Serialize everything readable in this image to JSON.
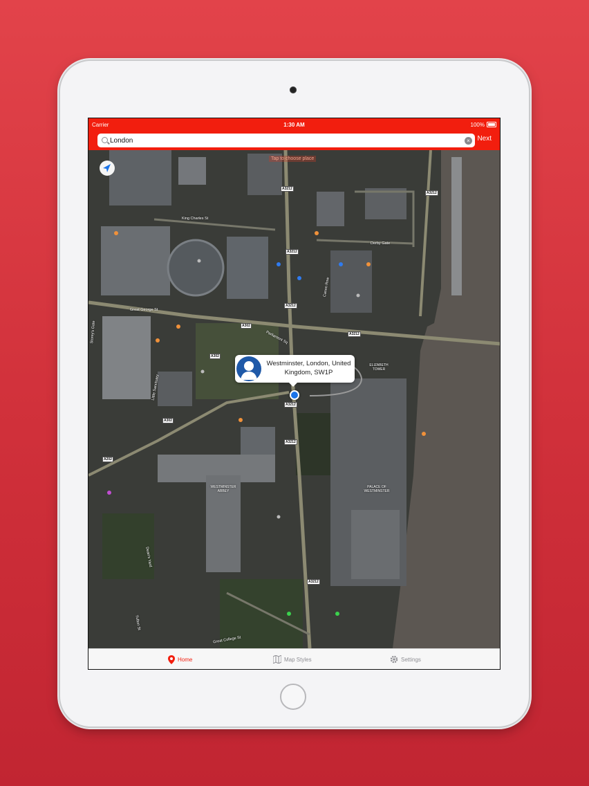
{
  "status_bar": {
    "carrier": "Carrier",
    "time": "1:30 AM",
    "battery": "100%"
  },
  "search": {
    "value": "London",
    "placeholder": "Search",
    "next_label": "Next"
  },
  "map": {
    "hint": "Tap to choose place",
    "callout_text": "Westminster, London, United Kingdom, SW1P",
    "road_labels": [
      "King Charles St",
      "Great George St",
      "Parliament Sq",
      "Derby Gate",
      "Canon Row",
      "Storey's Gate",
      "Little Sanctuary",
      "Great College St",
      "Dean's Yard",
      "Tufton St"
    ],
    "road_shields": [
      "A3212",
      "A302",
      "A202"
    ],
    "landmarks": [
      "ELIZABETH TOWER",
      "PALACE OF WESTMINSTER",
      "WESTMINSTER ABBEY"
    ]
  },
  "tabs": [
    {
      "label": "Home",
      "icon": "pin-icon",
      "active": true
    },
    {
      "label": "Map Styles",
      "icon": "map-icon",
      "active": false
    },
    {
      "label": "Settings",
      "icon": "gear-icon",
      "active": false
    }
  ],
  "colors": {
    "accent": "#f21e0e",
    "background": "#d8343d",
    "user_location": "#1a73e8"
  }
}
